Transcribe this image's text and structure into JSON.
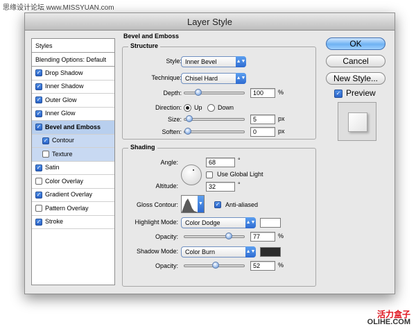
{
  "watermarks": {
    "top": "思缘设计论坛 www.MISSYUAN.com",
    "bottom_cn": "活力盒子",
    "bottom_en": "OLIHE.COM"
  },
  "title": "Layer Style",
  "styles_panel": {
    "header": "Styles",
    "blending": "Blending Options: Default",
    "items": [
      {
        "label": "Drop Shadow",
        "checked": true
      },
      {
        "label": "Inner Shadow",
        "checked": true
      },
      {
        "label": "Outer Glow",
        "checked": true
      },
      {
        "label": "Inner Glow",
        "checked": true
      },
      {
        "label": "Bevel and Emboss",
        "checked": true,
        "selected": true
      },
      {
        "label": "Contour",
        "checked": true,
        "sub": true
      },
      {
        "label": "Texture",
        "checked": false,
        "sub": true
      },
      {
        "label": "Satin",
        "checked": true
      },
      {
        "label": "Color Overlay",
        "checked": false
      },
      {
        "label": "Gradient Overlay",
        "checked": true
      },
      {
        "label": "Pattern Overlay",
        "checked": false
      },
      {
        "label": "Stroke",
        "checked": true
      }
    ]
  },
  "bevel": {
    "title": "Bevel and Emboss",
    "structure_title": "Structure",
    "style_label": "Style:",
    "style_value": "Inner Bevel",
    "technique_label": "Technique:",
    "technique_value": "Chisel Hard",
    "depth_label": "Depth:",
    "depth_value": "100",
    "depth_unit": "%",
    "depth_level": 0.2,
    "direction_label": "Direction:",
    "dir_up": "Up",
    "dir_down": "Down",
    "size_label": "Size:",
    "size_value": "5",
    "size_unit": "px",
    "size_level": 0.02,
    "soften_label": "Soften:",
    "soften_value": "0",
    "soften_unit": "px",
    "soften_level": 0.0
  },
  "shading": {
    "title": "Shading",
    "angle_label": "Angle:",
    "angle_value": "68",
    "angle_unit": "°",
    "global_light": "Use Global Light",
    "global_light_checked": false,
    "altitude_label": "Altitude:",
    "altitude_value": "32",
    "altitude_unit": "°",
    "gloss_label": "Gloss Contour:",
    "anti_aliased": "Anti-aliased",
    "anti_aliased_checked": true,
    "highlight_label": "Highlight Mode:",
    "highlight_value": "Color Dodge",
    "highlight_color": "#ffffff",
    "h_opacity_label": "Opacity:",
    "h_opacity_value": "77",
    "h_opacity_unit": "%",
    "h_opacity_level": 0.77,
    "shadow_label": "Shadow Mode:",
    "shadow_value": "Color Burn",
    "shadow_color": "#2c2c2c",
    "s_opacity_label": "Opacity:",
    "s_opacity_value": "52",
    "s_opacity_unit": "%",
    "s_opacity_level": 0.52
  },
  "buttons": {
    "ok": "OK",
    "cancel": "Cancel",
    "new_style": "New Style...",
    "preview": "Preview",
    "preview_checked": true
  }
}
